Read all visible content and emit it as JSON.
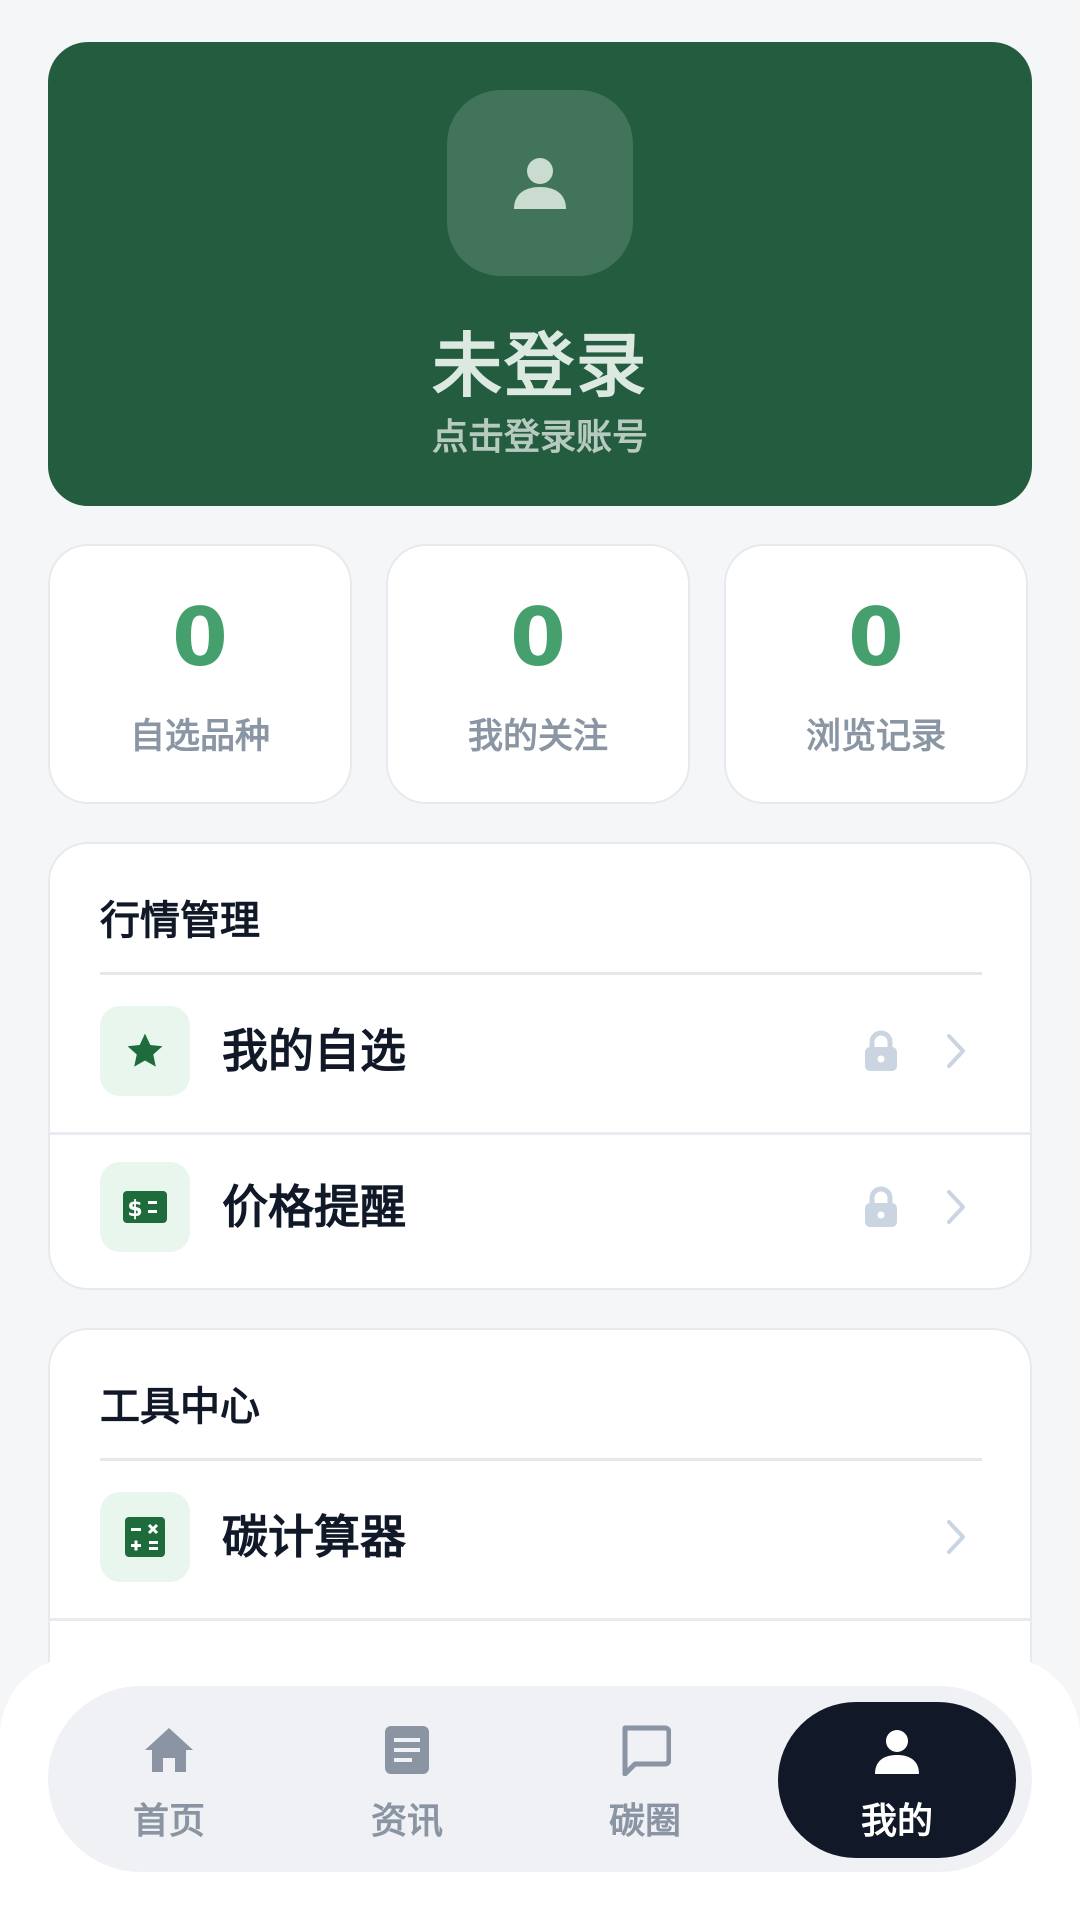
{
  "profile": {
    "name": "未登录",
    "subtitle": "点击登录账号",
    "avatar_icon": "user-icon"
  },
  "stats": [
    {
      "value": "0",
      "label": "自选品种"
    },
    {
      "value": "0",
      "label": "我的关注"
    },
    {
      "value": "0",
      "label": "浏览记录"
    }
  ],
  "market_section": {
    "title": "行情管理",
    "items": [
      {
        "label": "我的自选",
        "icon": "star-icon",
        "locked": true
      },
      {
        "label": "价格提醒",
        "icon": "dollar-bill-icon",
        "locked": true
      }
    ]
  },
  "tools_section": {
    "title": "工具中心",
    "items": [
      {
        "label": "碳计算器",
        "icon": "calculator-icon",
        "locked": false
      }
    ]
  },
  "bottom_nav": [
    {
      "label": "首页",
      "icon": "home-icon",
      "active": false
    },
    {
      "label": "资讯",
      "icon": "article-icon",
      "active": false
    },
    {
      "label": "碳圈",
      "icon": "chat-icon",
      "active": false
    },
    {
      "label": "我的",
      "icon": "user-icon",
      "active": true
    }
  ],
  "colors": {
    "profile_bg": "#245c40",
    "accent_green": "#46a06d",
    "icon_green": "#1e6b3b",
    "nav_active_bg": "#111827"
  }
}
